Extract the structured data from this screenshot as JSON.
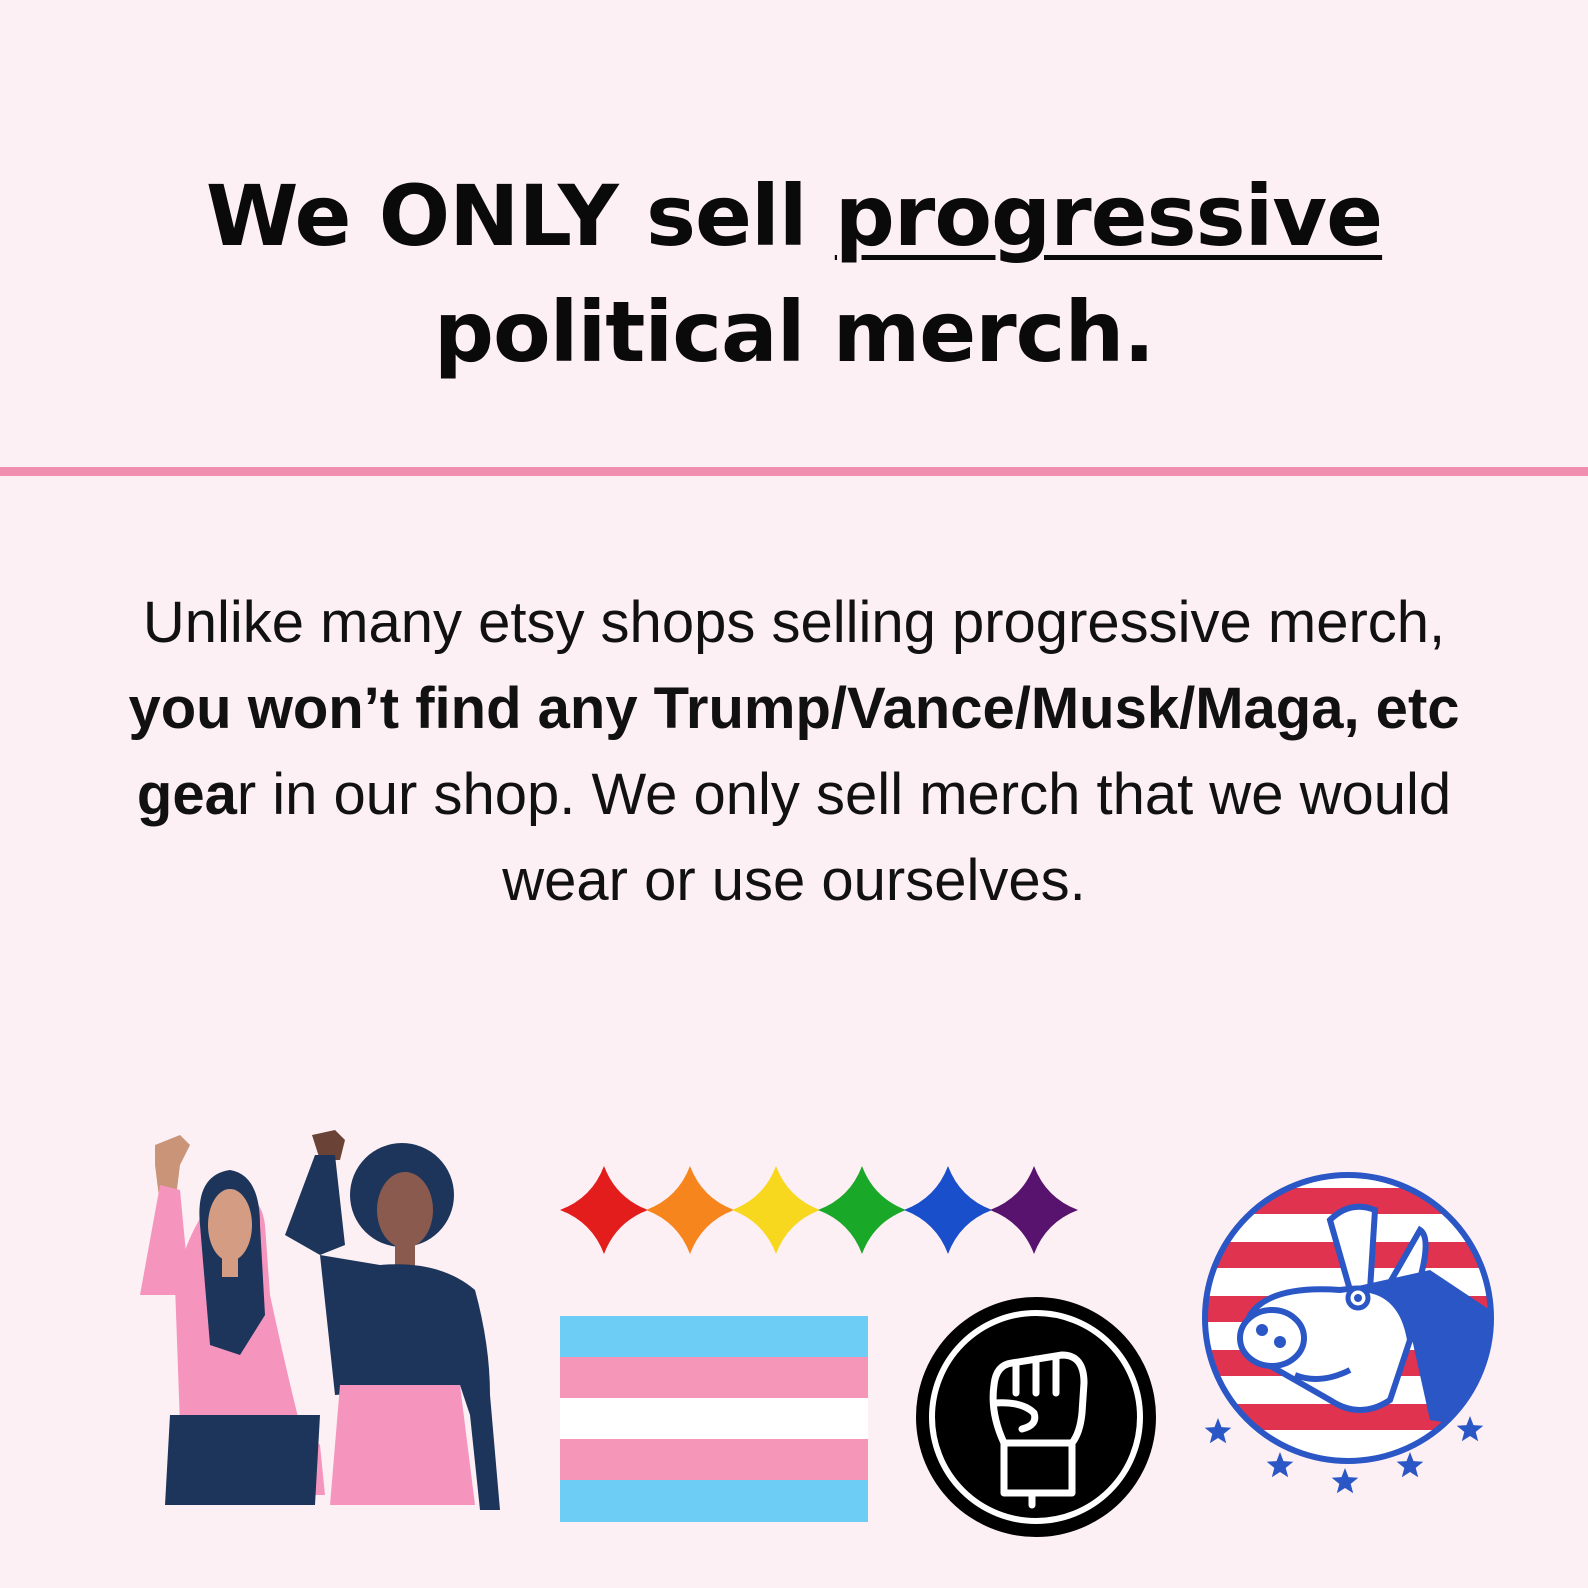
{
  "headline": {
    "part1": "We ONLY sell ",
    "underlined": "progressive",
    "part2": "political merch."
  },
  "body": {
    "text1": "Unlike many etsy shops selling progressive merch, ",
    "bold1": "you won’t find any Trump/Vance/Musk/Maga, etc gea",
    "text2": "r in our shop. We only sell merch that we would wear or use ourselves."
  },
  "colors": {
    "background": "#fdf0f4",
    "divider": "#f08fb0",
    "pink": "#f595be",
    "navy": "#1d355a",
    "trans_blue": "#6ecdf5",
    "trans_pink": "#f595b8",
    "rainbow": [
      "#e31c1c",
      "#f7851e",
      "#f7d81e",
      "#1aa829",
      "#1a4fcc",
      "#57136e"
    ],
    "flag_red": "#e0334f",
    "donkey_blue": "#2a56c6"
  },
  "icons": {
    "women": "two-women-raised-fists-illustration",
    "stars": "rainbow-sparkle-stars-icon",
    "trans_flag": "transgender-flag-icon",
    "fist": "raised-fist-circle-icon",
    "donkey": "democratic-donkey-emblem-icon"
  }
}
